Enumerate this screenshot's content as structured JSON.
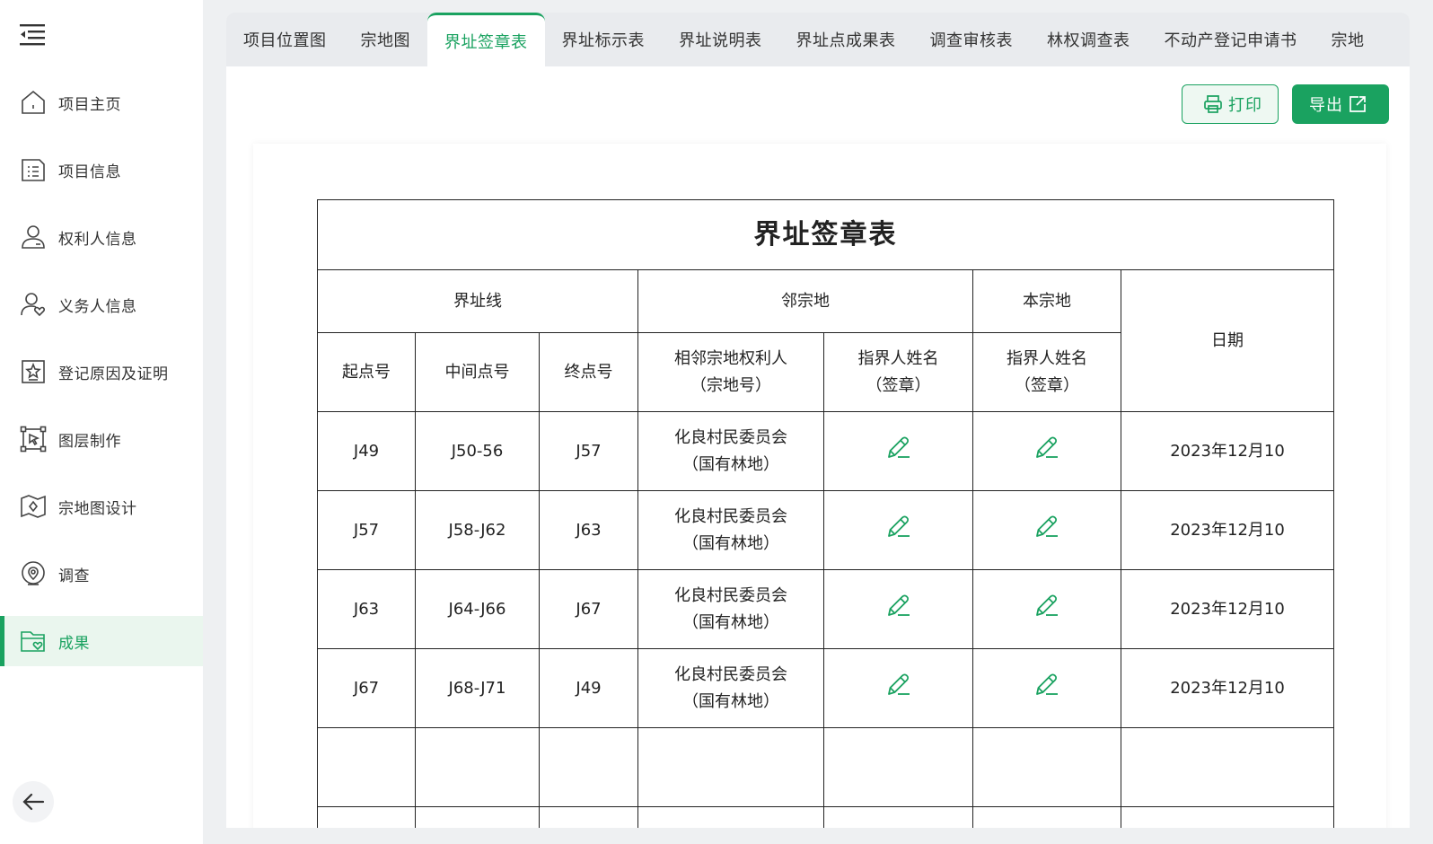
{
  "sidebar": {
    "items": [
      {
        "label": "项目主页",
        "icon": "home-icon"
      },
      {
        "label": "项目信息",
        "icon": "document-list-icon"
      },
      {
        "label": "权利人信息",
        "icon": "user-card-icon"
      },
      {
        "label": "义务人信息",
        "icon": "user-heart-icon"
      },
      {
        "label": "登记原因及证明",
        "icon": "star-badge-icon"
      },
      {
        "label": "图层制作",
        "icon": "cursor-frame-icon"
      },
      {
        "label": "宗地图设计",
        "icon": "map-icon"
      },
      {
        "label": "调查",
        "icon": "location-pin-icon"
      },
      {
        "label": "成果",
        "icon": "folder-heart-icon"
      }
    ],
    "active_index": 8
  },
  "tabs": [
    {
      "label": "项目位置图"
    },
    {
      "label": "宗地图"
    },
    {
      "label": "界址签章表"
    },
    {
      "label": "界址标示表"
    },
    {
      "label": "界址说明表"
    },
    {
      "label": "界址点成果表"
    },
    {
      "label": "调查审核表"
    },
    {
      "label": "林权调查表"
    },
    {
      "label": "不动产登记申请书"
    },
    {
      "label": "宗地"
    }
  ],
  "toolbar": {
    "print_label": "打印",
    "export_label": "导出"
  },
  "table": {
    "title": "界址签章表",
    "group_headers": {
      "boundary_line": "界址线",
      "neighbor": "邻宗地",
      "own": "本宗地",
      "date": "日期"
    },
    "sub_headers": {
      "start": "起点号",
      "middle": "中间点号",
      "end": "终点号",
      "neighbor_owner_line1": "相邻宗地权利人",
      "neighbor_owner_line2": "（宗地号）",
      "neighbor_sign_line1": "指界人姓名",
      "neighbor_sign_line2": "（签章）",
      "own_sign_line1": "指界人姓名",
      "own_sign_line2": "（签章）"
    },
    "rows": [
      {
        "start": "J49",
        "middle": "J50-56",
        "end": "J57",
        "owner_line1": "化良村民委员会",
        "owner_line2": "（国有林地）",
        "date": "2023年12月10"
      },
      {
        "start": "J57",
        "middle": "J58-J62",
        "end": "J63",
        "owner_line1": "化良村民委员会",
        "owner_line2": "（国有林地）",
        "date": "2023年12月10"
      },
      {
        "start": "J63",
        "middle": "J64-J66",
        "end": "J67",
        "owner_line1": "化良村民委员会",
        "owner_line2": "（国有林地）",
        "date": "2023年12月10"
      },
      {
        "start": "J67",
        "middle": "J68-J71",
        "end": "J49",
        "owner_line1": "化良村民委员会",
        "owner_line2": "（国有林地）",
        "date": "2023年12月10"
      },
      {
        "start": "",
        "middle": "",
        "end": "",
        "owner_line1": "",
        "owner_line2": "",
        "date": ""
      },
      {
        "start": "",
        "middle": "",
        "end": "",
        "owner_line1": "",
        "owner_line2": "",
        "date": ""
      }
    ]
  },
  "colors": {
    "accent": "#1aa260",
    "text": "#222222",
    "tab_bar": "#e9ebee",
    "background": "#eef0f2"
  }
}
